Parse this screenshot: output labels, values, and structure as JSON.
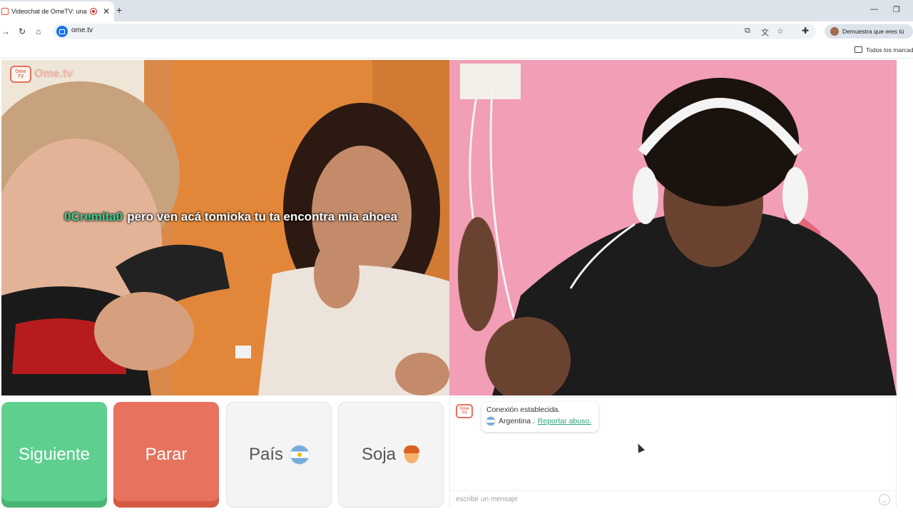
{
  "browser": {
    "tab_title": "Videochat de OmeTV: una",
    "tab_close": "✕",
    "new_tab": "+",
    "url": "ome.tv",
    "profile_label": "Demuestra que eres tú",
    "bookmarks_label": "Todos los marcad",
    "window_minimize": "—",
    "window_restore": "❐"
  },
  "icons": {
    "back": "back-arrow-icon",
    "reload": "reload-icon",
    "home": "home-icon",
    "install": "install-app-icon",
    "translate": "translate-icon",
    "bookmark": "star-icon",
    "extensions": "puzzle-icon"
  },
  "video": {
    "logo_text": "Ome.tv",
    "logo_badge": "Ome TV",
    "caption_user": "0Cremita0",
    "caption_message": "pero ven acá tomioka tu ta encontra mía ahoea"
  },
  "controls": {
    "next_label": "Siguiente",
    "stop_label": "Parar",
    "country_label": "País",
    "gender_label": "Soja"
  },
  "chat": {
    "logo_badge": "Ome TV",
    "status": "Conexión establecida.",
    "country": "Argentina .",
    "report_link": "Reportar abuso.",
    "input_placeholder": "escribir un mensaje"
  },
  "colors": {
    "next": "#5fcf8f",
    "stop": "#e7735e",
    "caption_user": "#3ecf8e",
    "link": "#2aa37a"
  }
}
